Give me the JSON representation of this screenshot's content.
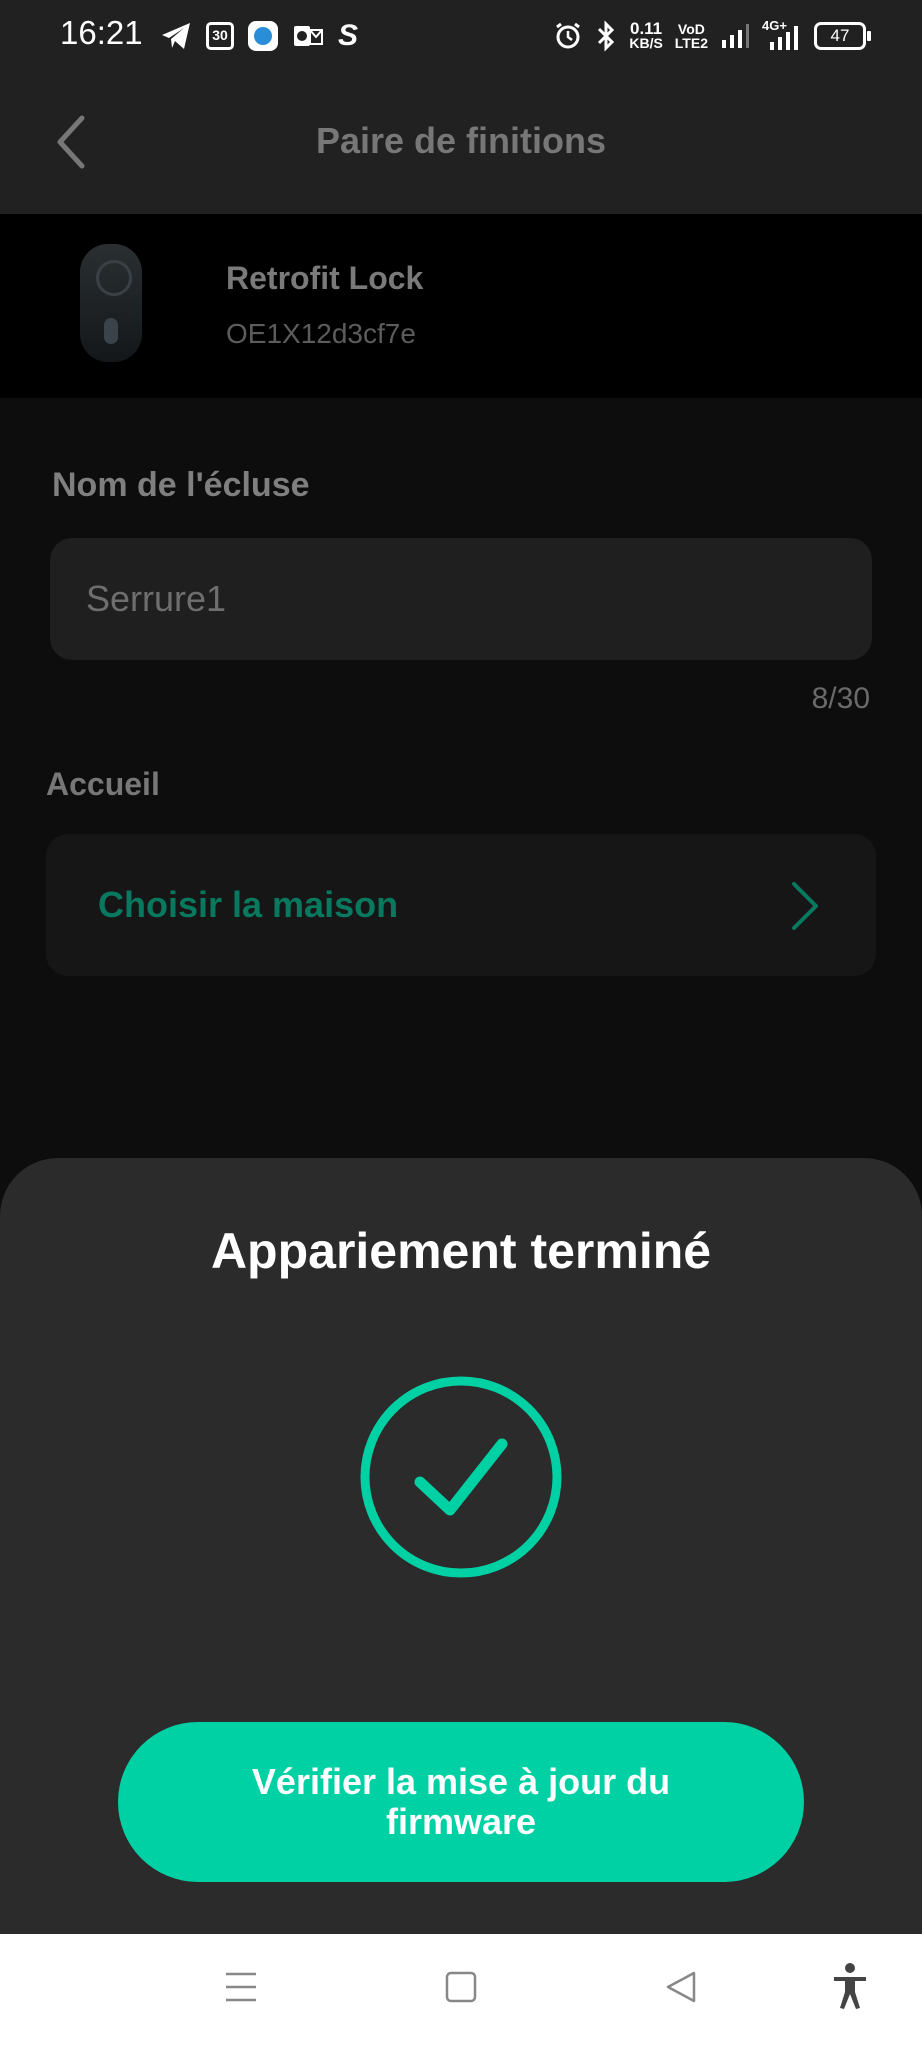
{
  "status_bar": {
    "time": "16:21",
    "calendar_day": "30",
    "net_speed_value": "0.11",
    "net_speed_unit": "KB/S",
    "volte_top": "VoD",
    "volte_bottom": "LTE2",
    "network_type": "4G+",
    "battery": "47"
  },
  "header": {
    "title": "Paire de finitions"
  },
  "device": {
    "name": "Retrofit Lock",
    "id": "OE1X12d3cf7e"
  },
  "form": {
    "name_label": "Nom de l'écluse",
    "name_value": "Serrure1",
    "counter": "8/30",
    "home_label": "Accueil",
    "home_action": "Choisir la maison"
  },
  "sheet": {
    "title": "Appariement terminé",
    "button": "Vérifier la mise à jour du firmware"
  },
  "colors": {
    "accent": "#00d1a4",
    "accent_dim": "#08795f",
    "background": "#0d0d0d"
  }
}
